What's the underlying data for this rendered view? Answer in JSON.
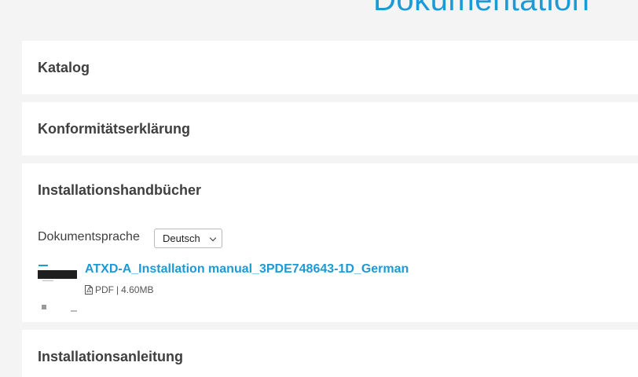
{
  "page": {
    "title": "Dokumentation"
  },
  "sections": {
    "katalog": {
      "title": "Katalog"
    },
    "konformitaet": {
      "title": "Konformitätserklärung"
    },
    "installationshandbuecher": {
      "title": "Installationshandbücher",
      "language_label": "Dokumentsprache",
      "language_selected": "Deutsch",
      "document": {
        "title": "ATXD-A_Installation manual_3PDE748643-1D_German",
        "file_type": "PDF",
        "separator": "|",
        "file_size": "4.60MB",
        "icon": "pdf-file-icon",
        "thumbnail": "document-thumbnail"
      }
    },
    "installationsanleitung": {
      "title": "Installationsanleitung"
    }
  },
  "colors": {
    "accent": "#1c9ad6",
    "background": "#f4f4f4",
    "card": "#ffffff",
    "text": "#3f3f3f"
  }
}
